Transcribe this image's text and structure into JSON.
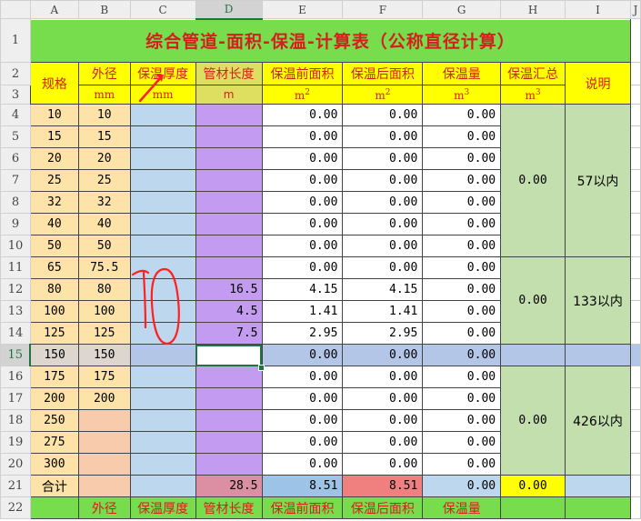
{
  "columns": [
    "A",
    "B",
    "C",
    "D",
    "E",
    "F",
    "G",
    "H",
    "I",
    "J"
  ],
  "title": "综合管道-面积-保温-计算表（公称直径计算）",
  "headers": {
    "spec": "规格",
    "outer_diameter": "外径",
    "insulation_thickness": "保温厚度",
    "pipe_length": "管材长度",
    "area_before": "保温前面积",
    "area_after": "保温后面积",
    "insulation_volume": "保温量",
    "insulation_total": "保温汇总",
    "note": "说明"
  },
  "units": {
    "mm1": "mm",
    "mm2": "mm",
    "m": "m",
    "m2a": "m",
    "m2b": "m",
    "m3a": "m",
    "m3b": "m",
    "sq": "2",
    "cu": "3"
  },
  "rows": [
    {
      "num": "4",
      "spec": "10",
      "od": "10",
      "len": "",
      "e": "0.00",
      "f": "0.00",
      "g": "0.00"
    },
    {
      "num": "5",
      "spec": "15",
      "od": "15",
      "len": "",
      "e": "0.00",
      "f": "0.00",
      "g": "0.00"
    },
    {
      "num": "6",
      "spec": "20",
      "od": "20",
      "len": "",
      "e": "0.00",
      "f": "0.00",
      "g": "0.00"
    },
    {
      "num": "7",
      "spec": "25",
      "od": "25",
      "len": "",
      "e": "0.00",
      "f": "0.00",
      "g": "0.00"
    },
    {
      "num": "8",
      "spec": "32",
      "od": "32",
      "len": "",
      "e": "0.00",
      "f": "0.00",
      "g": "0.00"
    },
    {
      "num": "9",
      "spec": "40",
      "od": "40",
      "len": "",
      "e": "0.00",
      "f": "0.00",
      "g": "0.00"
    },
    {
      "num": "10",
      "spec": "50",
      "od": "50",
      "len": "",
      "e": "0.00",
      "f": "0.00",
      "g": "0.00"
    },
    {
      "num": "11",
      "spec": "65",
      "od": "75.5",
      "len": "",
      "e": "0.00",
      "f": "0.00",
      "g": "0.00"
    },
    {
      "num": "12",
      "spec": "80",
      "od": "80",
      "len": "16.5",
      "e": "4.15",
      "f": "4.15",
      "g": "0.00"
    },
    {
      "num": "13",
      "spec": "100",
      "od": "100",
      "len": "4.5",
      "e": "1.41",
      "f": "1.41",
      "g": "0.00"
    },
    {
      "num": "14",
      "spec": "125",
      "od": "125",
      "len": "7.5",
      "e": "2.95",
      "f": "2.95",
      "g": "0.00"
    },
    {
      "num": "15",
      "spec": "150",
      "od": "150",
      "len": "",
      "e": "0.00",
      "f": "0.00",
      "g": "0.00"
    },
    {
      "num": "16",
      "spec": "175",
      "od": "175",
      "len": "",
      "e": "0.00",
      "f": "0.00",
      "g": "0.00"
    },
    {
      "num": "17",
      "spec": "200",
      "od": "200",
      "len": "",
      "e": "0.00",
      "f": "0.00",
      "g": "0.00"
    },
    {
      "num": "18",
      "spec": "250",
      "od": "",
      "len": "",
      "e": "0.00",
      "f": "0.00",
      "g": "0.00"
    },
    {
      "num": "19",
      "spec": "275",
      "od": "",
      "len": "",
      "e": "0.00",
      "f": "0.00",
      "g": "0.00"
    },
    {
      "num": "20",
      "spec": "300",
      "od": "",
      "len": "",
      "e": "0.00",
      "f": "0.00",
      "g": "0.00"
    }
  ],
  "groups": [
    {
      "total": "0.00",
      "note": "57以内"
    },
    {
      "total": "0.00",
      "note": "133以内"
    },
    {
      "total": "0.00",
      "note": "426以内"
    }
  ],
  "totals": {
    "label": "合计",
    "d": "28.5",
    "e": "8.51",
    "f": "8.51",
    "g": "0.00",
    "h": "0.00"
  },
  "footer": {
    "b": "外径",
    "c": "保温厚度",
    "d": "管材长度",
    "e": "保温前面积",
    "f": "保温后面积",
    "g": "保温量"
  },
  "row_numbers": {
    "r1": "1",
    "r2": "2",
    "r3": "3",
    "r21": "21",
    "r22": "22"
  },
  "annotation": {
    "handwritten_number": "10",
    "color": "#ff2020"
  },
  "colors": {
    "title_bg": "#77dd4c",
    "header_bg": "#ffff00",
    "selected_green": "#217346",
    "text_red": "#d31f1f"
  }
}
